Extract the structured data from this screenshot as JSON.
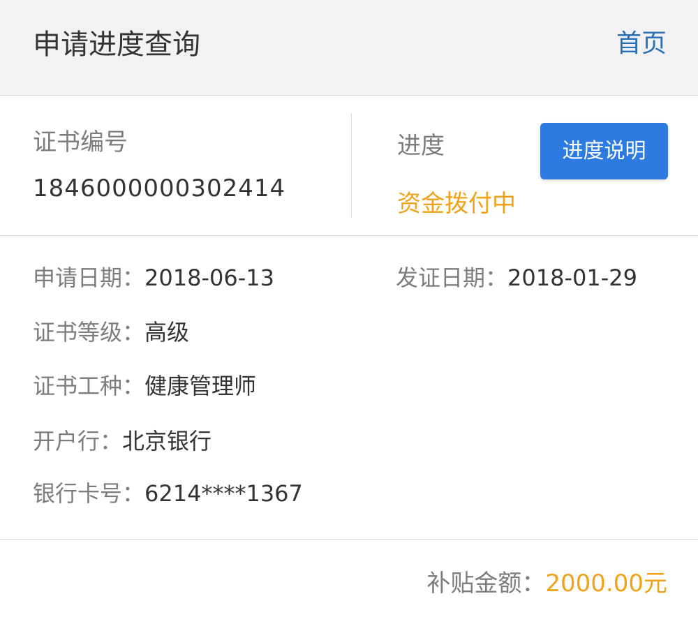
{
  "header": {
    "title": "申请进度查询",
    "home_link": "首页"
  },
  "certificate": {
    "number_label": "证书编号",
    "number_value": "1846000000302414",
    "progress_label": "进度",
    "progress_status": "资金拨付中",
    "progress_button": "进度说明"
  },
  "details": {
    "apply_date_label": "申请日期：",
    "apply_date_value": "2018-06-13",
    "issue_date_label": "发证日期：",
    "issue_date_value": "2018-01-29",
    "level_label": "证书等级：",
    "level_value": "高级",
    "job_type_label": "证书工种：",
    "job_type_value": "健康管理师",
    "bank_label": "开户行：",
    "bank_value": "北京银行",
    "card_label": "银行卡号：",
    "card_value": "6214****1367"
  },
  "subsidy": {
    "label": "补贴金额：",
    "value": "2000.00元"
  },
  "colors": {
    "accent_blue": "#2d7be0",
    "link_blue": "#2a6fb5",
    "status_orange": "#f0a31a"
  }
}
